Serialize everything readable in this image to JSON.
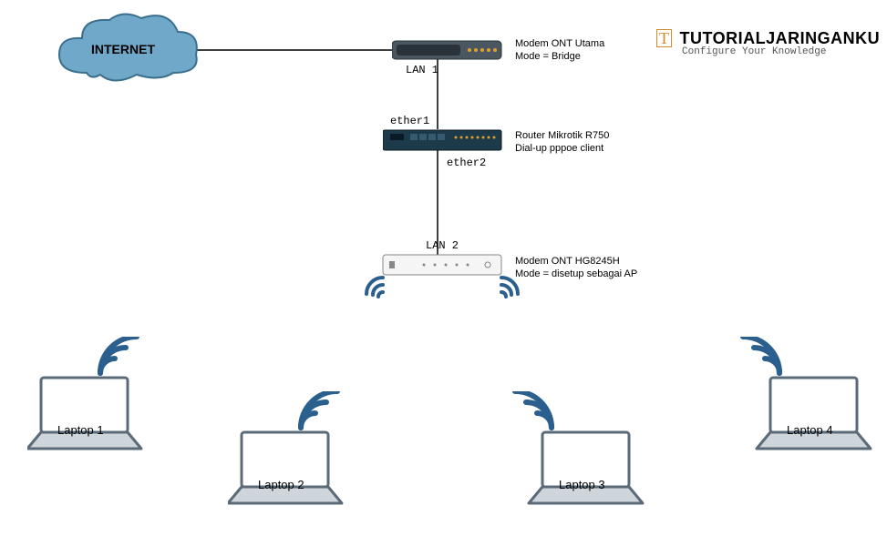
{
  "cloud_label": "INTERNET",
  "modem1": {
    "title": "Modem ONT Utama",
    "mode": "Mode = Bridge",
    "port": "LAN 1"
  },
  "router": {
    "title": "Router Mikrotik R750",
    "mode": "Dial-up pppoe client",
    "port_in": "ether1",
    "port_out": "ether2"
  },
  "modem2": {
    "title": "Modem ONT HG8245H",
    "mode": "Mode = disetup sebagai AP",
    "port": "LAN 2"
  },
  "laptops": {
    "l1": "Laptop 1",
    "l2": "Laptop 2",
    "l3": "Laptop 3",
    "l4": "Laptop 4"
  },
  "logo": {
    "main": "TUTORIALJARINGANKU",
    "sub": "Configure Your Knowledge",
    "mark": "T"
  }
}
